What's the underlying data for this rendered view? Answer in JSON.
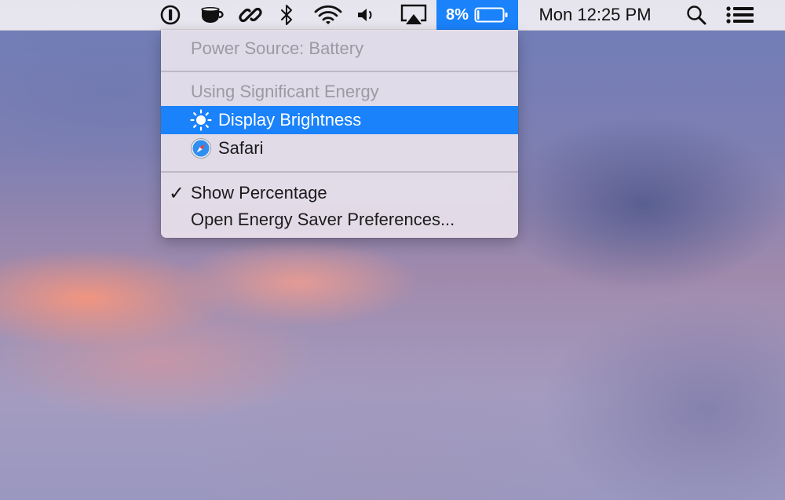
{
  "menubar": {
    "status_icons": [
      {
        "name": "1password-icon"
      },
      {
        "name": "caffeine-cup-icon"
      },
      {
        "name": "link-icon"
      },
      {
        "name": "bluetooth-icon"
      },
      {
        "name": "wifi-icon"
      },
      {
        "name": "volume-icon"
      },
      {
        "name": "airplay-icon"
      }
    ],
    "battery": {
      "percent_label": "8%",
      "level": 0.08,
      "highlight_color": "#1a82fb"
    },
    "clock": "Mon 12:25 PM",
    "right_icons": [
      {
        "name": "spotlight-search-icon"
      },
      {
        "name": "notification-center-icon"
      }
    ]
  },
  "battery_menu": {
    "power_source": "Power Source: Battery",
    "energy_header": "Using Significant Energy",
    "apps": [
      {
        "label": "Display Brightness",
        "icon": "brightness-icon",
        "highlighted": true
      },
      {
        "label": "Safari",
        "icon": "safari-icon",
        "highlighted": false
      }
    ],
    "show_percentage": {
      "label": "Show Percentage",
      "checked": true,
      "check_glyph": "✓"
    },
    "open_prefs": "Open Energy Saver Preferences..."
  }
}
